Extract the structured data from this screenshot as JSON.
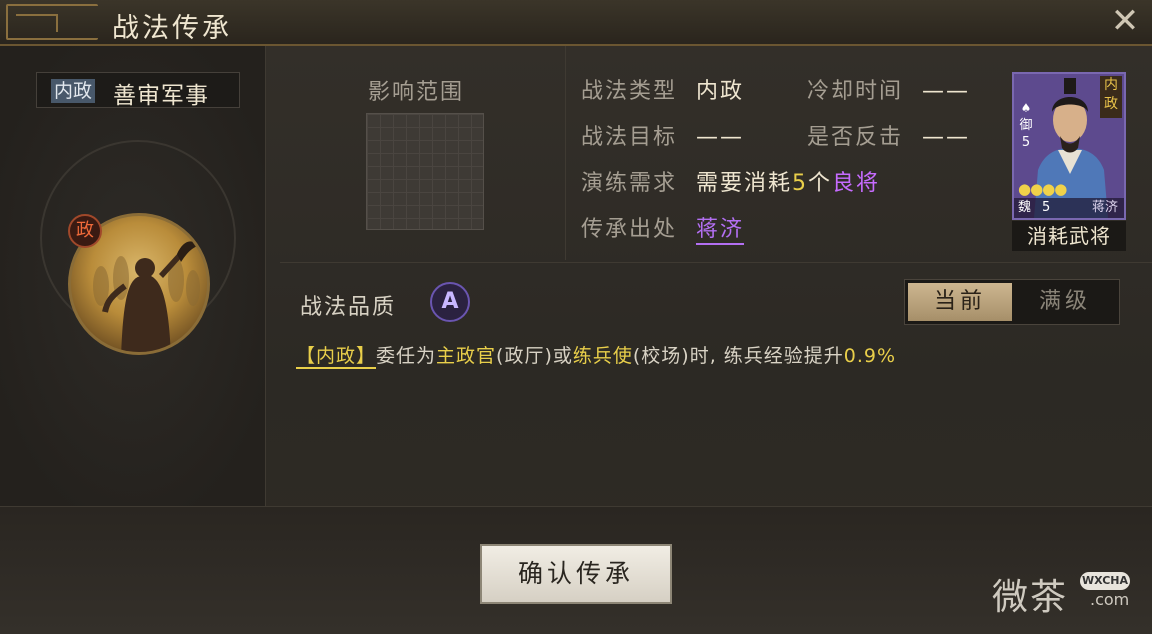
{
  "window": {
    "title": "战法传承",
    "close_glyph": "✕"
  },
  "skill": {
    "type_tag": "内政",
    "name": "善审军事",
    "faction_badge": "政"
  },
  "range": {
    "label": "影响范围"
  },
  "info": {
    "type_label": "战法类型",
    "type_value": "内政",
    "cooldown_label": "冷却时间",
    "cooldown_value": "——",
    "target_label": "战法目标",
    "target_value": "——",
    "counter_label": "是否反击",
    "counter_value": "——",
    "requirement_label": "演练需求",
    "requirement_prefix": "需要消耗",
    "requirement_count": "5",
    "requirement_unit": "个",
    "requirement_quality": "良将",
    "source_label": "传承出处",
    "source_value": "蒋济"
  },
  "general_card": {
    "tag": "内政",
    "troop": "御",
    "cost": "5",
    "stars": "●●●●",
    "faction": "魏",
    "level": "5",
    "name": "蒋济",
    "caption": "消耗武将"
  },
  "quality": {
    "label": "战法品质",
    "grade": "A"
  },
  "level_toggle": {
    "current": "当前",
    "max": "满级"
  },
  "description": {
    "tag": "【内政】",
    "t1": "委任为",
    "h1": "主政官",
    "t2": "(政厅)或",
    "h2": "练兵使",
    "t3": "(校场)时, 练兵经验提升",
    "h3": "0.9%"
  },
  "confirm": {
    "label": "确认传承"
  },
  "watermark": {
    "text": "微茶",
    "badge": "WXCHA",
    "domain": ".com"
  },
  "colors": {
    "accent_gold": "#e9cf4a",
    "accent_purple": "#c66bff",
    "frame": "#2c2924"
  }
}
